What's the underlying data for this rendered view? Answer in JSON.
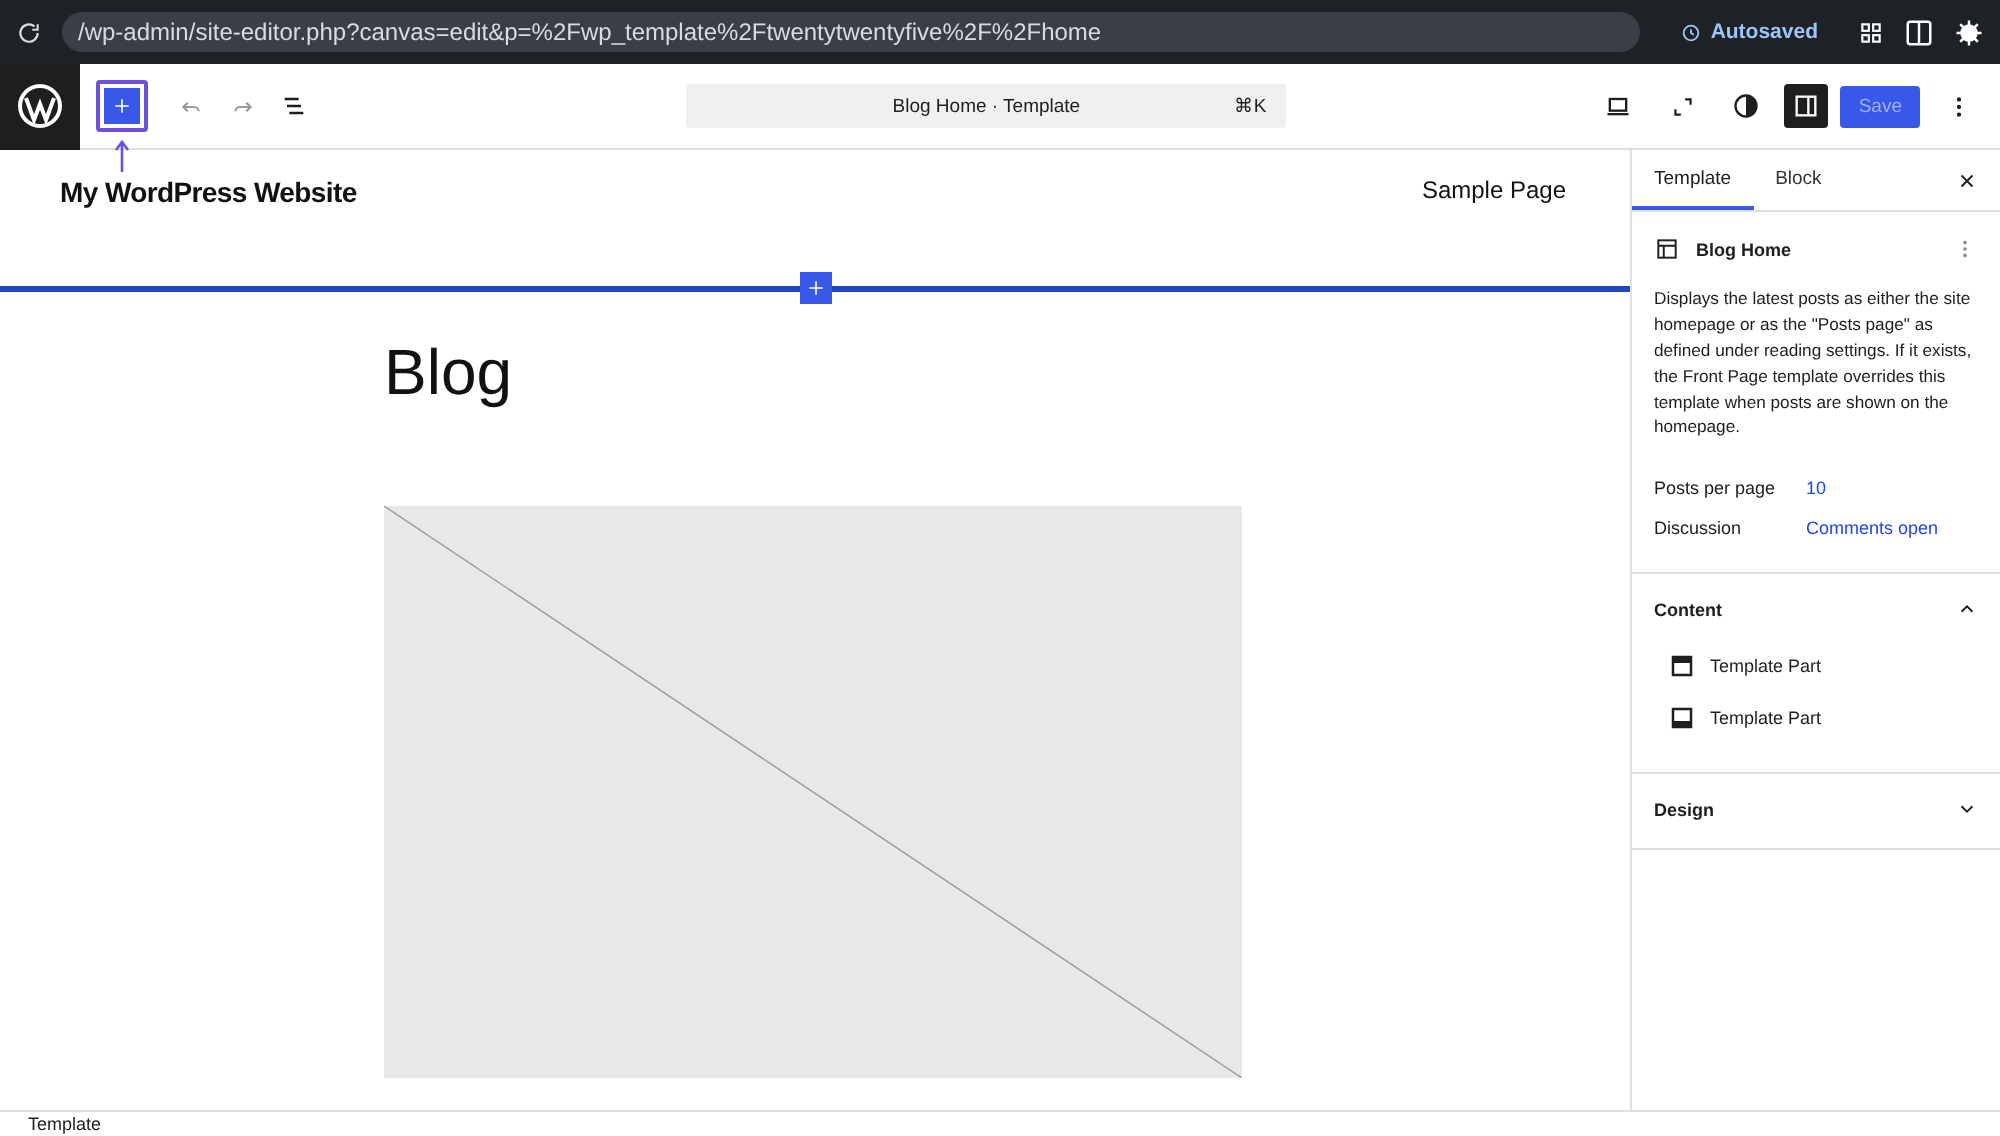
{
  "browser": {
    "url": "/wp-admin/site-editor.php?canvas=edit&p=%2Fwp_template%2Ftwentytwentyfive%2F%2Fhome",
    "status": "Autosaved"
  },
  "toolbar": {
    "document_title": "Blog Home · Template",
    "shortcut": "⌘K",
    "save": {
      "label": "Save",
      "disabled": true
    },
    "inserter_highlighted": true,
    "settings_open": true
  },
  "canvas": {
    "site_title": "My WordPress Website",
    "nav_item": "Sample Page",
    "heading": "Blog"
  },
  "sidebar": {
    "tabs": [
      {
        "label": "Template",
        "selected": true
      },
      {
        "label": "Block",
        "selected": false
      }
    ],
    "template_name": "Blog Home",
    "description": "Displays the latest posts as either the site homepage or as the \"Posts page\" as defined under reading settings. If it exists, the Front Page template overrides this template when posts are shown on the homepage.",
    "properties": [
      {
        "label": "Posts per page",
        "value": "10"
      },
      {
        "label": "Discussion",
        "value": "Comments open"
      }
    ],
    "panels": [
      {
        "title": "Content",
        "expanded": true,
        "items": [
          {
            "label": "Template Part",
            "kind": "header"
          },
          {
            "label": "Template Part",
            "kind": "footer"
          }
        ]
      },
      {
        "title": "Design",
        "expanded": false
      }
    ]
  },
  "status_bar": {
    "breadcrumb": "Template"
  }
}
